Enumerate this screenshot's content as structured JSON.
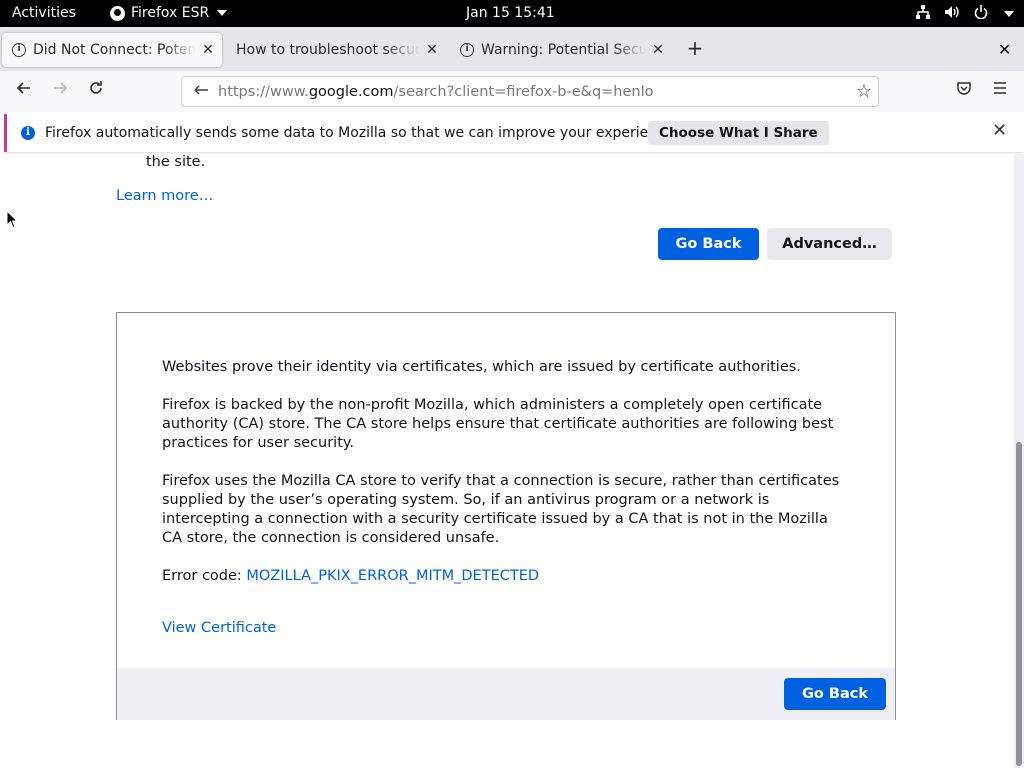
{
  "system_bar": {
    "activities": "Activities",
    "app_name": "Firefox ESR",
    "clock": "Jan 15  15:41"
  },
  "tabs": [
    {
      "title": "Did Not Connect: Potential Security Issue",
      "active": true
    },
    {
      "title": "How to troubleshoot security error codes",
      "active": false
    },
    {
      "title": "Warning: Potential Security Risk Ahead",
      "active": false
    }
  ],
  "toolbar": {
    "new_tab": "+",
    "url_prefix": "https://www.",
    "url_host": "google.com",
    "url_path": "/search?client=firefox-b-e&q=henlo"
  },
  "notification": {
    "message": "Firefox automatically sends some data to Mozilla so that we can improve your experience.",
    "button": "Choose What I Share"
  },
  "page": {
    "fragment": "the site.",
    "learn_more": "Learn more…",
    "go_back": "Go Back",
    "advanced": "Advanced…",
    "advanced_panel": {
      "p1": "Websites prove their identity via certificates, which are issued by certificate authorities.",
      "p2": "Firefox is backed by the non-profit Mozilla, which administers a completely open certificate authority (CA) store. The CA store helps ensure that certificate authorities are following best practices for user security.",
      "p3": "Firefox uses the Mozilla CA store to verify that a connection is secure, rather than certificates supplied by the user’s operating system. So, if an antivirus program or a network is intercepting a connection with a security certificate issued by a CA that is not in the Mozilla CA store, the connection is considered unsafe.",
      "error_label": "Error code: ",
      "error_code": "MOZILLA_PKIX_ERROR_MITM_DETECTED",
      "view_certificate": "View Certificate",
      "go_back": "Go Back"
    }
  },
  "colors": {
    "accent": "#0061e0",
    "notification_stripe": "#c33c9c"
  }
}
